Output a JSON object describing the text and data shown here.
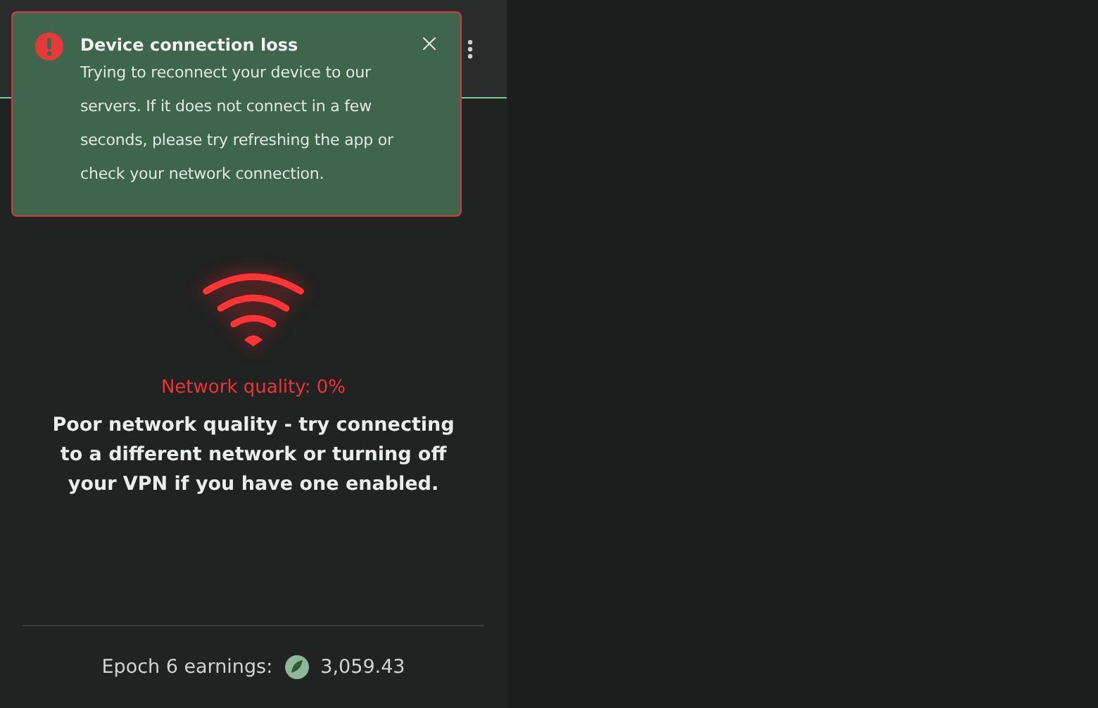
{
  "toast": {
    "title": "Device connection loss",
    "message": "Trying to reconnect your device to our servers. If it does not connect in a few seconds, please try refreshing the app or check your network connection."
  },
  "network": {
    "quality": "Network quality: 0%",
    "advice": "Poor network quality - try connecting to a different network or turning off your VPN if you have one enabled."
  },
  "earnings": {
    "label": "Epoch 6 earnings:",
    "amount": "3,059.43"
  }
}
